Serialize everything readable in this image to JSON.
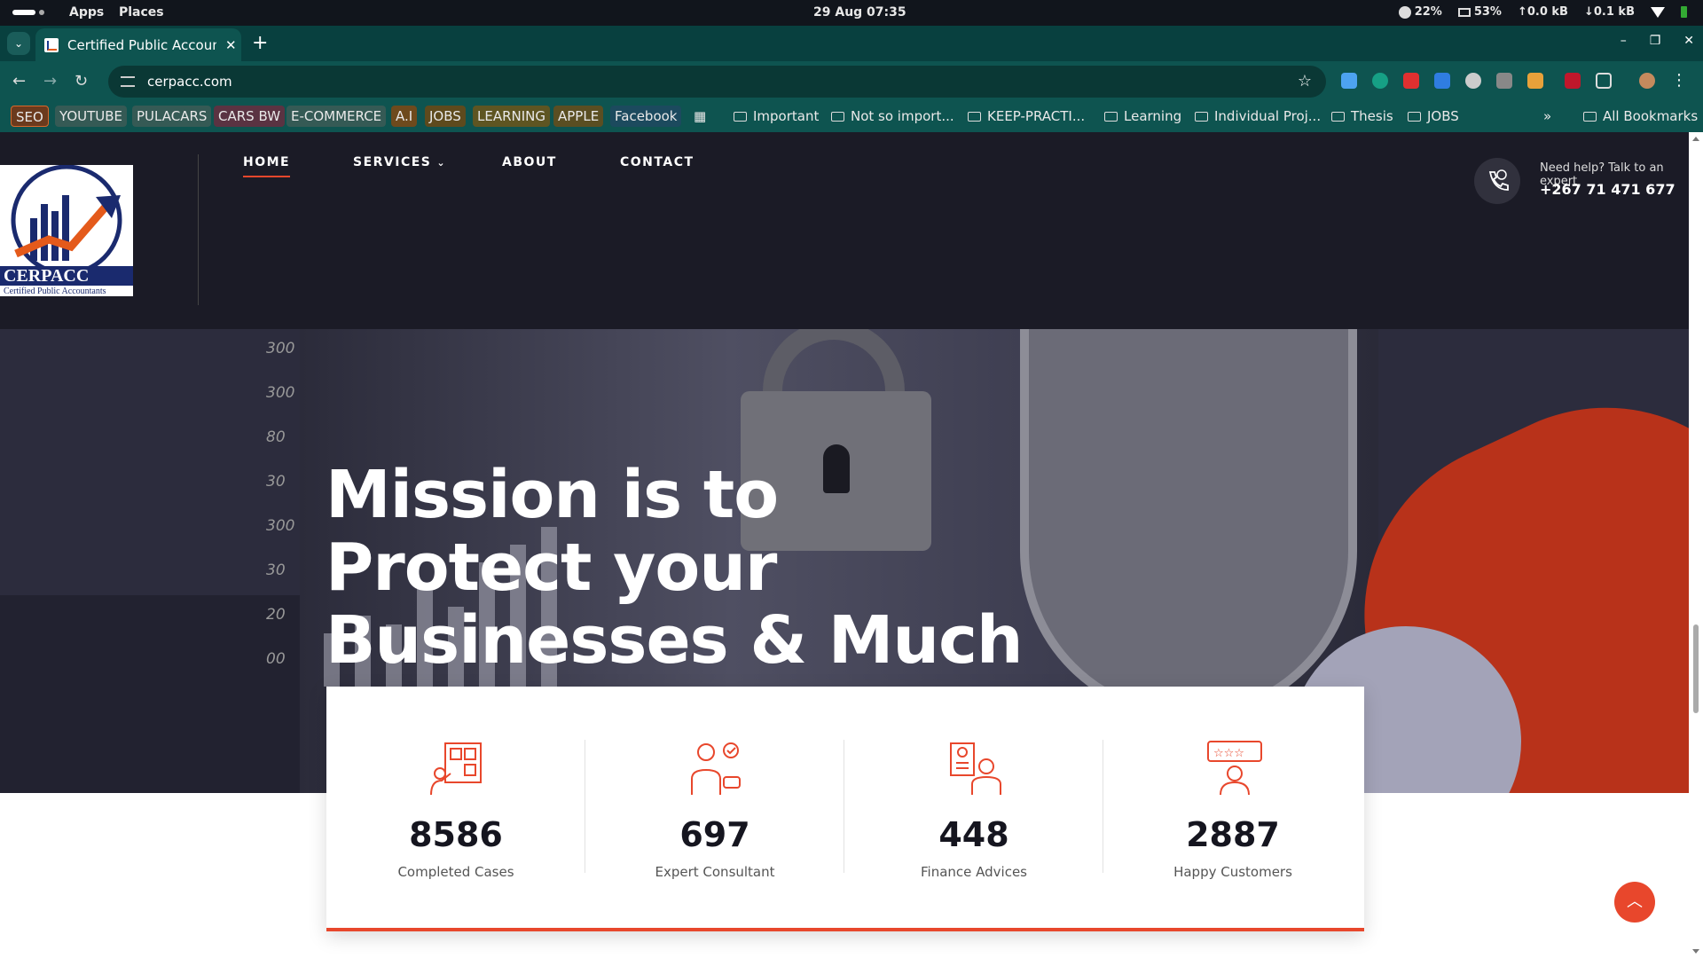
{
  "system": {
    "apps": "Apps",
    "places": "Places",
    "clock": "29 Aug  07:35",
    "cpu": "22%",
    "mem": "53%",
    "up": "↑0.0 kB",
    "down": "↓0.1 kB"
  },
  "browser": {
    "tab_title": "Certified Public Accountants",
    "close": "✕",
    "newtab": "+",
    "url": "cerpacc.com",
    "winctl": [
      "–",
      "❐",
      "✕"
    ]
  },
  "bookmarks": [
    {
      "label": "SEO",
      "bg": "#d9682b"
    },
    {
      "label": "YOUTUBE",
      "bg": "#5b6b68"
    },
    {
      "label": "PULACARS",
      "bg": "#5b6b68"
    },
    {
      "label": "CARS BW",
      "bg": "#7b3a50"
    },
    {
      "label": "E-COMMERCE",
      "bg": "#5b6b68"
    },
    {
      "label": "A.I",
      "bg": "#9a5a22"
    },
    {
      "label": "JOBS",
      "bg": "#7a5a1d"
    },
    {
      "label": "LEARNING",
      "bg": "#7a6a2a"
    },
    {
      "label": "APPLE",
      "bg": "#6b5a2a"
    },
    {
      "label": "Facebook",
      "bg": "#264e66"
    }
  ],
  "bookmark_folders": [
    "Important",
    "Not so import...",
    "KEEP-PRACTI...",
    "Learning",
    "Individual Proj...",
    "Thesis",
    "JOBS"
  ],
  "all_bookmarks": "All Bookmarks",
  "site": {
    "logo_text": "CERPACC",
    "logo_sub": "Certified Public Accountants",
    "nav": [
      "HOME",
      "SERVICES",
      "ABOUT",
      "CONTACT"
    ],
    "help_text": "Need help? Talk to an expert",
    "phone": "+267 71 471 677",
    "headline": "Mission is to Protect your Businesses & Much More",
    "chart_ticks": [
      "300",
      "300",
      "80",
      "30",
      "300",
      "30",
      "20",
      "00"
    ],
    "stats": [
      {
        "number": "8586",
        "label": "Completed Cases"
      },
      {
        "number": "697",
        "label": "Expert Consultant"
      },
      {
        "number": "448",
        "label": "Finance Advices"
      },
      {
        "number": "2887",
        "label": "Happy Customers"
      }
    ],
    "accent": "#e8472c"
  }
}
